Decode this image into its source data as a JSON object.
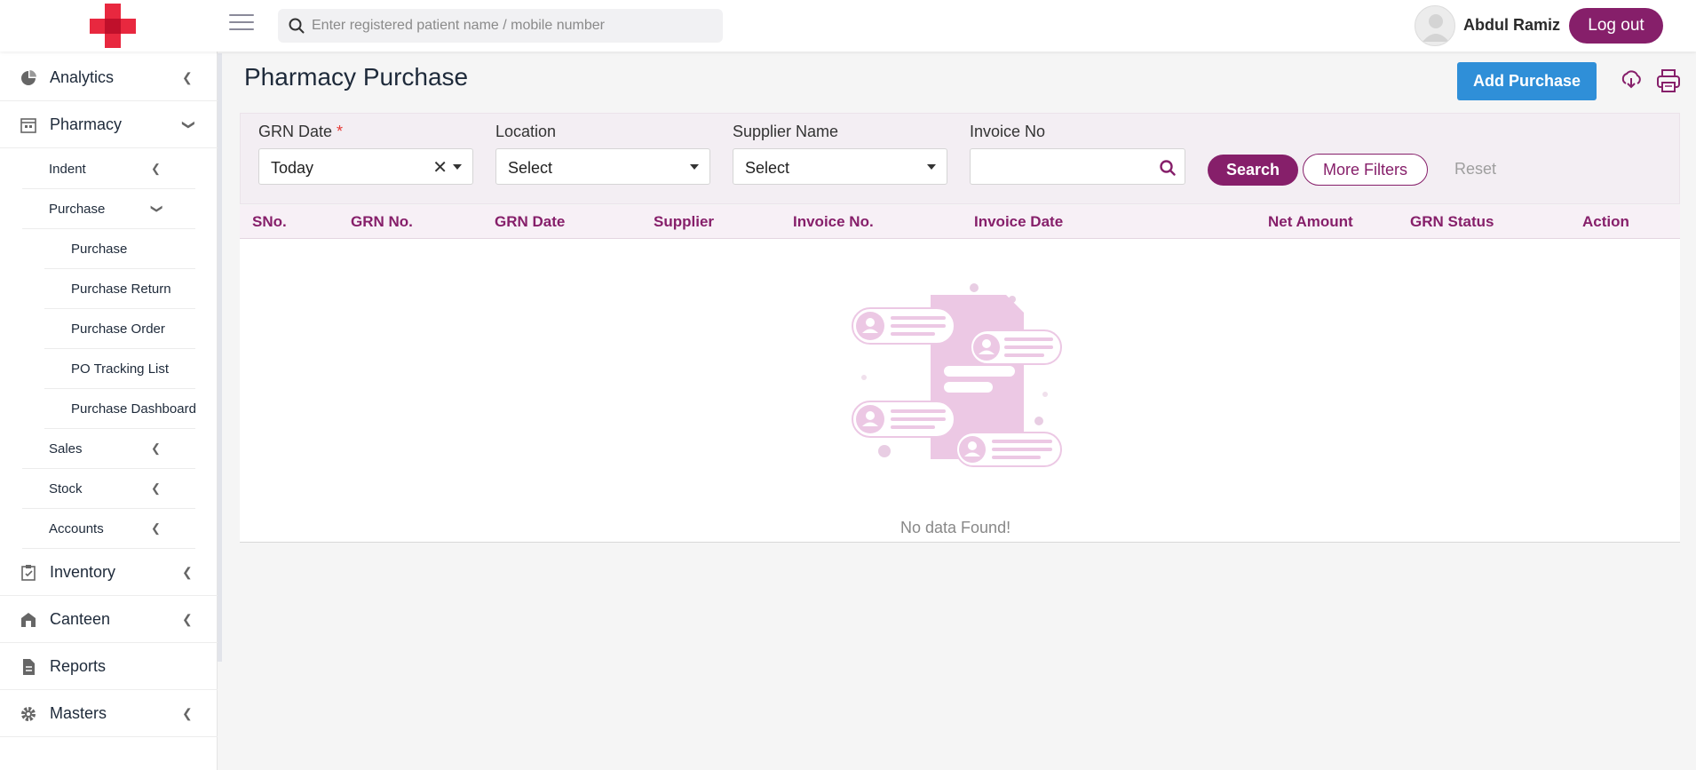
{
  "header": {
    "search_placeholder": "Enter registered patient name / mobile number",
    "user_name": "Abdul Ramiz",
    "logout_label": "Log out"
  },
  "sidebar": {
    "items": [
      {
        "label": "Analytics",
        "icon": "pie-chart-icon",
        "expanded": false
      },
      {
        "label": "Pharmacy",
        "icon": "store-icon",
        "expanded": true
      },
      {
        "label": "Inventory",
        "icon": "clipboard-check-icon",
        "expanded": false
      },
      {
        "label": "Canteen",
        "icon": "canteen-icon",
        "expanded": false
      },
      {
        "label": "Reports",
        "icon": "document-icon",
        "expanded": false
      },
      {
        "label": "Masters",
        "icon": "gear-icon",
        "expanded": false
      }
    ],
    "pharmacy_sub": [
      {
        "label": "Indent"
      },
      {
        "label": "Purchase",
        "expanded": true
      },
      {
        "label": "Sales"
      },
      {
        "label": "Stock"
      },
      {
        "label": "Accounts"
      }
    ],
    "purchase_sub": [
      {
        "label": "Purchase"
      },
      {
        "label": "Purchase Return"
      },
      {
        "label": "Purchase Order"
      },
      {
        "label": "PO Tracking List"
      },
      {
        "label": "Purchase Dashboard"
      }
    ]
  },
  "main": {
    "title": "Pharmacy Purchase",
    "add_label": "Add Purchase",
    "filters": {
      "grn_date_label": "GRN Date",
      "grn_date_required": "*",
      "grn_date_value": "Today",
      "location_label": "Location",
      "location_value": "Select",
      "supplier_label": "Supplier Name",
      "supplier_value": "Select",
      "invoice_label": "Invoice No",
      "invoice_value": "",
      "search_label": "Search",
      "more_label": "More Filters",
      "reset_label": "Reset"
    },
    "table": {
      "columns": [
        "SNo.",
        "GRN No.",
        "GRN Date",
        "Supplier",
        "Invoice No.",
        "Invoice Date",
        "Net Amount",
        "GRN Status",
        "Action"
      ],
      "rows": [],
      "empty_text": "No data Found!"
    }
  },
  "colors": {
    "brand": "#861f6a",
    "primary_button": "#2f8fd8",
    "logo_red": "#e8283f"
  }
}
